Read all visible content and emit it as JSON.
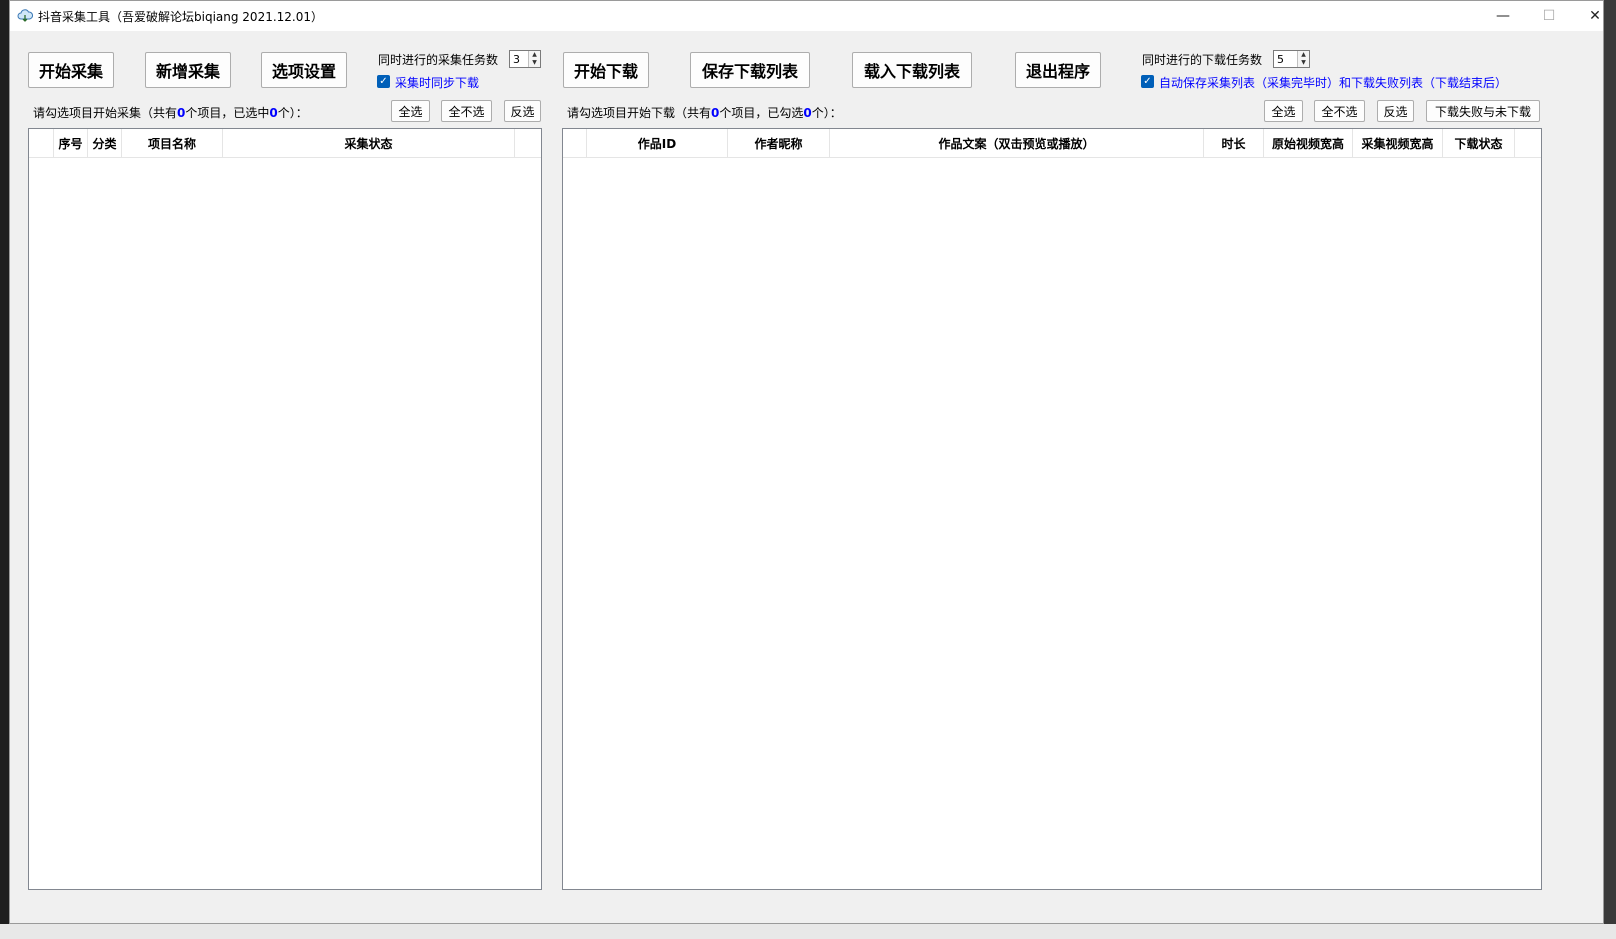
{
  "window": {
    "title": "抖音采集工具（吾爱破解论坛biqiang 2021.12.01）",
    "minimize": "—",
    "maximize": "☐",
    "close": "✕"
  },
  "collect": {
    "start_button": "开始采集",
    "new_button": "新增采集",
    "options_button": "选项设置",
    "concurrent_label": "同时进行的采集任务数",
    "concurrent_value": "3",
    "sync_download_label": "采集时同步下载",
    "status_prefix": "请勾选项目开始采集（共有",
    "total_count": "0",
    "status_mid": "个项目，已选中",
    "selected_count": "0",
    "status_suffix": "个）：",
    "select_all": "全选",
    "select_none": "全不选",
    "invert": "反选",
    "columns": [
      "序号",
      "分类",
      "项目名称",
      "采集状态"
    ]
  },
  "download": {
    "start_button": "开始下载",
    "save_button": "保存下载列表",
    "load_button": "载入下载列表",
    "exit_button": "退出程序",
    "concurrent_label": "同时进行的下载任务数",
    "concurrent_value": "5",
    "auto_save_label": "自动保存采集列表（采集完毕时）和下载失败列表（下载结束后）",
    "status_prefix": "请勾选项目开始下载（共有",
    "total_count": "0",
    "status_mid": "个项目，已勾选",
    "selected_count": "0",
    "status_suffix": "个）：",
    "select_all": "全选",
    "select_none": "全不选",
    "invert": "反选",
    "failed_button": "下载失败与未下载",
    "columns": [
      "作品ID",
      "作者昵称",
      "作品文案（双击预览或播放）",
      "时长",
      "原始视频宽高",
      "采集视频宽高",
      "下载状态"
    ]
  }
}
